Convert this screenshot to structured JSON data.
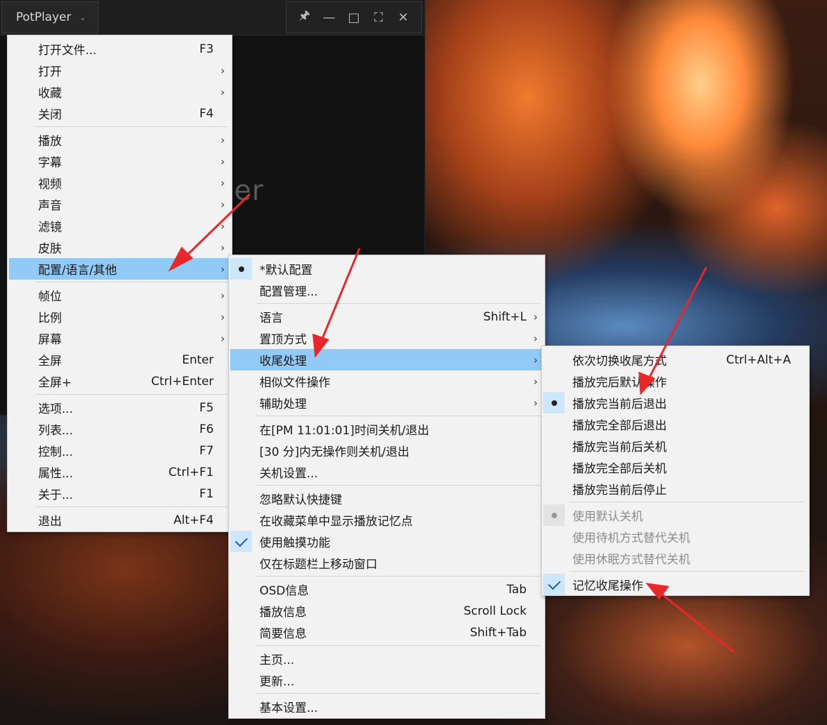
{
  "window": {
    "app_name": "PotPlayer",
    "logo_text": "Player"
  },
  "main_menu": {
    "items": [
      {
        "label": "打开文件...",
        "shortcut": "F3"
      },
      {
        "label": "打开"
      },
      {
        "label": "收藏"
      },
      {
        "label": "关闭",
        "shortcut": "F4"
      },
      {
        "label": "播放"
      },
      {
        "label": "字幕"
      },
      {
        "label": "视频"
      },
      {
        "label": "声音"
      },
      {
        "label": "滤镜"
      },
      {
        "label": "皮肤"
      },
      {
        "label": "配置/语言/其他",
        "highlighted": true
      },
      {
        "label": "帧位"
      },
      {
        "label": "比例"
      },
      {
        "label": "屏幕"
      },
      {
        "label": "全屏",
        "shortcut": "Enter"
      },
      {
        "label": "全屏+",
        "shortcut": "Ctrl+Enter"
      },
      {
        "label": "选项...",
        "shortcut": "F5"
      },
      {
        "label": "列表...",
        "shortcut": "F6"
      },
      {
        "label": "控制...",
        "shortcut": "F7"
      },
      {
        "label": "属性...",
        "shortcut": "Ctrl+F1"
      },
      {
        "label": "关于...",
        "shortcut": "F1"
      },
      {
        "label": "退出",
        "shortcut": "Alt+F4"
      }
    ]
  },
  "config_menu": {
    "items": [
      {
        "label": "*默认配置",
        "mark": "dot"
      },
      {
        "label": "配置管理..."
      },
      {
        "label": "语言",
        "shortcut": "Shift+L"
      },
      {
        "label": "置顶方式"
      },
      {
        "label": "收尾处理",
        "highlighted": true
      },
      {
        "label": "相似文件操作"
      },
      {
        "label": "辅助处理"
      },
      {
        "label": "在[PM 11:01:01]时间关机/退出"
      },
      {
        "label": "[30 分]内无操作则关机/退出"
      },
      {
        "label": "关机设置..."
      },
      {
        "label": "忽略默认快捷键"
      },
      {
        "label": "在收藏菜单中显示播放记忆点"
      },
      {
        "label": "使用触摸功能",
        "mark": "check"
      },
      {
        "label": "仅在标题栏上移动窗口"
      },
      {
        "label": "OSD信息",
        "shortcut": "Tab"
      },
      {
        "label": "播放信息",
        "shortcut": "Scroll Lock"
      },
      {
        "label": "简要信息",
        "shortcut": "Shift+Tab"
      },
      {
        "label": "主页..."
      },
      {
        "label": "更新..."
      },
      {
        "label": "基本设置..."
      }
    ]
  },
  "ending_menu": {
    "items": [
      {
        "label": "依次切换收尾方式",
        "shortcut": "Ctrl+Alt+A"
      },
      {
        "label": "播放完后默认操作"
      },
      {
        "label": "播放完当前后退出",
        "mark": "dot"
      },
      {
        "label": "播放完全部后退出"
      },
      {
        "label": "播放完当前后关机"
      },
      {
        "label": "播放完全部后关机"
      },
      {
        "label": "播放完当前后停止"
      },
      {
        "label": "使用默认关机",
        "mark": "dot",
        "disabled": true
      },
      {
        "label": "使用待机方式替代关机",
        "disabled": true
      },
      {
        "label": "使用休眠方式替代关机",
        "disabled": true
      },
      {
        "label": "记忆收尾操作",
        "mark": "check"
      }
    ]
  },
  "colors": {
    "highlight": "#91c9f7",
    "menu_bg": "#f2f2f2",
    "annotation_arrow": "#e8272a"
  }
}
